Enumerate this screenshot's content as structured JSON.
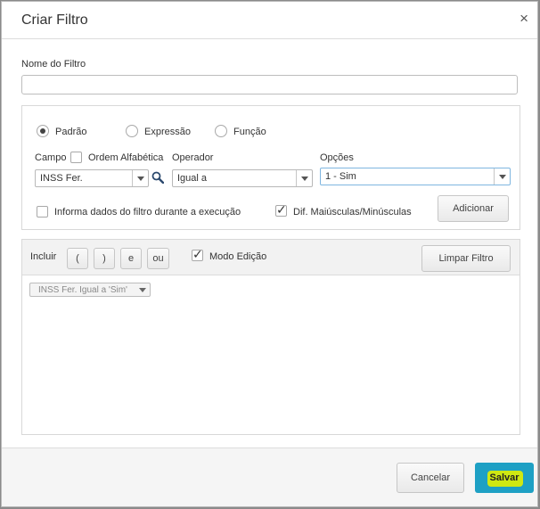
{
  "dialog": {
    "title": "Criar Filtro",
    "close_symbol": "×"
  },
  "filter_name": {
    "label": "Nome do Filtro",
    "value": ""
  },
  "mode": {
    "options": [
      "Padrão",
      "Expressão",
      "Função"
    ],
    "selected": "Padrão"
  },
  "campo": {
    "label": "Campo",
    "order_label": "Ordem Alfabética",
    "order_checked": false,
    "value": "INSS Fer."
  },
  "operador": {
    "label": "Operador",
    "value": "Igual a"
  },
  "opcoes": {
    "label": "Opções",
    "value": "1 - Sim"
  },
  "informa": {
    "label": "Informa dados do filtro durante a execução",
    "checked": false
  },
  "dif": {
    "label": "Dif. Maiúsculas/Minúsculas",
    "checked": true
  },
  "add_label": "Adicionar",
  "builder": {
    "incluir_label": "Incluir",
    "buttons": [
      "(",
      ")",
      "e",
      "ou"
    ],
    "modo_edicao_label": "Modo Edição",
    "modo_edicao_checked": true,
    "clear_label": "Limpar Filtro",
    "expression_chip": "INSS Fer. Igual a 'Sim'"
  },
  "footer": {
    "cancel_label": "Cancelar",
    "save_label": "Salvar"
  },
  "colors": {
    "save_button": "#1ea0c4",
    "save_highlight": "#cfe812",
    "focus_border": "#7fb6e0"
  },
  "icons": {
    "close": "close-icon",
    "search": "search-icon",
    "dropdown": "chevron-down-icon",
    "check": "checkmark-icon"
  }
}
